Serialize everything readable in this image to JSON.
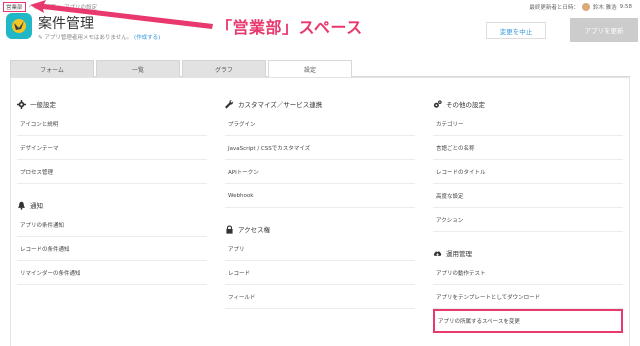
{
  "breadcrumb": [
    "営業部",
    "案件管理",
    "アプリの設定"
  ],
  "annotation": "「営業部」スペース",
  "header": {
    "meta_label": "最終更新者と日時：",
    "meta_user": "鈴木 雅浩",
    "meta_time": "9:58",
    "app_title": "案件管理",
    "app_desc": "アプリ管理者用メモはありません。",
    "app_desc_link": "(作成する)",
    "cancel_label": "変更を中止",
    "update_label": "アプリを更新"
  },
  "tabs": [
    {
      "label": "フォーム",
      "active": false
    },
    {
      "label": "一覧",
      "active": false
    },
    {
      "label": "グラフ",
      "active": false
    },
    {
      "label": "設定",
      "active": true
    }
  ],
  "columns": [
    {
      "sections": [
        {
          "title": "一般設定",
          "icon": "gear-icon",
          "items": [
            "アイコンと説明",
            "デザインテーマ",
            "プロセス管理"
          ]
        },
        {
          "title": "通知",
          "icon": "bell-icon",
          "items": [
            "アプリの条件通知",
            "レコードの条件通知",
            "リマインダーの条件通知"
          ]
        }
      ]
    },
    {
      "sections": [
        {
          "title": "カスタマイズ／サービス連携",
          "icon": "wrench-icon",
          "items": [
            "プラグイン",
            "JavaScript / CSSでカスタマイズ",
            "APIトークン",
            "Webhook"
          ]
        },
        {
          "title": "アクセス権",
          "icon": "lock-icon",
          "items": [
            "アプリ",
            "レコード",
            "フィールド"
          ]
        }
      ]
    },
    {
      "sections": [
        {
          "title": "その他の設定",
          "icon": "gears-icon",
          "items": [
            "カテゴリー",
            "言語ごとの名称",
            "レコードのタイトル",
            "高度な設定",
            "アクション"
          ]
        },
        {
          "title": "運用管理",
          "icon": "cloud-download-icon",
          "items": [
            "アプリの動作テスト",
            "アプリをテンプレートとしてダウンロード",
            "アプリの所属するスペースを変更"
          ]
        }
      ]
    }
  ],
  "colors": {
    "accent": "#e8386e",
    "link": "#3498db",
    "app_icon_bg": "#21b7c4"
  }
}
